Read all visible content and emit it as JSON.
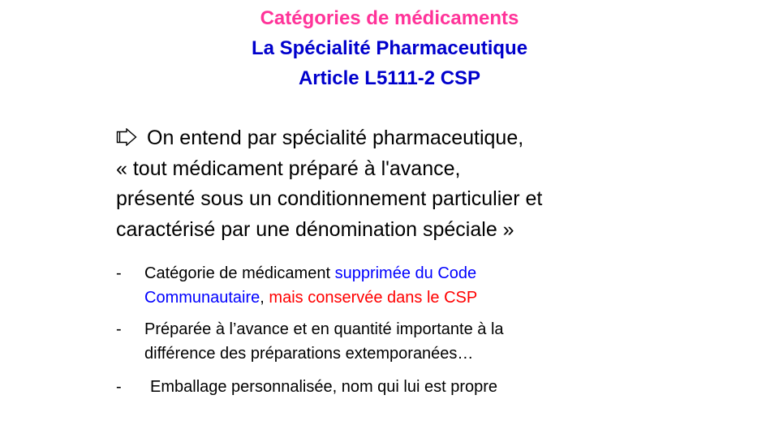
{
  "title": {
    "line1": "Catégories de médicaments",
    "line2": "La Spécialité Pharmaceutique",
    "line3": "Article L5111-2 CSP"
  },
  "definition": {
    "icon": "arrow-icon",
    "line1": "On entend par spécialité pharmaceutique,",
    "line2": "« tout médicament préparé à l'avance,",
    "line3": "présenté sous un conditionnement particulier et",
    "line4": "caractérisé par une dénomination spéciale »"
  },
  "bullets": [
    {
      "dash": "-",
      "text_black": "Catégorie de médicament ",
      "text_blue_a": "supprimée du Code",
      "text_blue_b": "Communautaire",
      "text_sep": ", ",
      "text_red": "mais conservée dans le CSP"
    },
    {
      "dash": "-",
      "line1": "Préparée à l’avance et en quantité importante à la",
      "line2": "différence des préparations extemporanées…"
    },
    {
      "dash": "-",
      "text": "Emballage personnalisée, nom qui lui est propre"
    }
  ],
  "colors": {
    "title_pink": "#ff3399",
    "title_blue": "#0000cc",
    "highlight_blue": "#0000ff",
    "highlight_red": "#ff0000"
  }
}
